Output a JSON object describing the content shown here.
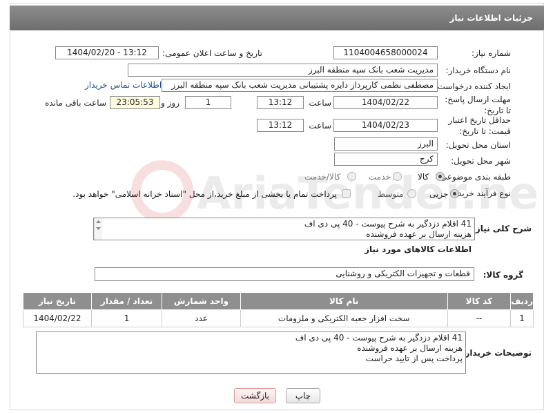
{
  "header": {
    "title": "جزئیات اطلاعات نیاز"
  },
  "form": {
    "need_number_label": "شماره نیاز:",
    "need_number": "1104004658000024",
    "announce_label": "تاریخ و ساعت اعلان عمومی:",
    "announce_value": "1404/02/20 - 13:12",
    "buyer_label": "نام دستگاه خریدار:",
    "buyer_value": "مدیریت شعب بانک سپه منطقه البرز",
    "creator_label": "ایجاد کننده درخواست:",
    "creator_value": "مصطفی نظمی کارپرداز دایره پشتیبانی مدیریت شعب بانک سپه منطقه البرز",
    "contact_link": "اطلاعات تماس خریدار",
    "deadline_label": "مهلت ارسال پاسخ: تا تاریخ:",
    "deadline_date": "1404/02/22",
    "time_label": "ساعت",
    "deadline_time": "13:12",
    "days_value": "1",
    "days_label": "روز و",
    "remaining_time": "23:05:53",
    "remaining_label": "ساعت باقی مانده",
    "validity_label": "حداقل تاریخ اعتبار قیمت: تا تاریخ:",
    "validity_date": "1404/02/23",
    "validity_time": "13:12",
    "province_label": "استان محل تحویل:",
    "province_value": "البرز",
    "city_label": "شهر محل تحویل:",
    "city_value": "کرج",
    "category_label": "طبقه بندی موضوعی:",
    "category_options": [
      "کالا",
      "خدمت",
      "کالا/خدمت"
    ],
    "process_label": "نوع فرآیند خرید :",
    "process_options": [
      "جزیی",
      "متوسط"
    ],
    "payment_note": "پرداخت تمام یا بخشی از مبلغ خرید،از محل \"اسناد خزانه اسلامی\" خواهد بود.",
    "summary_label": "شرح کلی نیاز:",
    "summary_lines": [
      "41 اقلام دزدگیر به شرح پیوست - 40 پی دی اف",
      "هزینه ارسال بر عهده فروشنده"
    ],
    "goods_info_title": "اطلاعات کالاهای مورد نیاز",
    "goods_group_label": "گروه کالا:",
    "goods_group_value": "قطعات و تجهیزات الکتریکی و روشنایی"
  },
  "table": {
    "headers": [
      "ردیف",
      "کد کالا",
      "نام کالا",
      "واحد شمارش",
      "تعداد / مقدار",
      "تاریخ نیاز"
    ],
    "rows": [
      {
        "row": "1",
        "code": "--",
        "name": "سخت افزار جعبه الکتریکی و ملزومات",
        "unit": "عدد",
        "qty": "1",
        "date": "1404/02/22"
      }
    ]
  },
  "buyer_notes": {
    "label": "توضیحات خریدار:",
    "lines": [
      "41 اقلام دزدگیر به شرح پیوست - 40 پی دی اف",
      "هزینه ارسال بر عهده فروشنده",
      "پرداخت پس از تایید حراست"
    ]
  },
  "buttons": {
    "print": "چاپ",
    "back": "بازگشت"
  },
  "watermark_text": "AriaTender.neT"
}
